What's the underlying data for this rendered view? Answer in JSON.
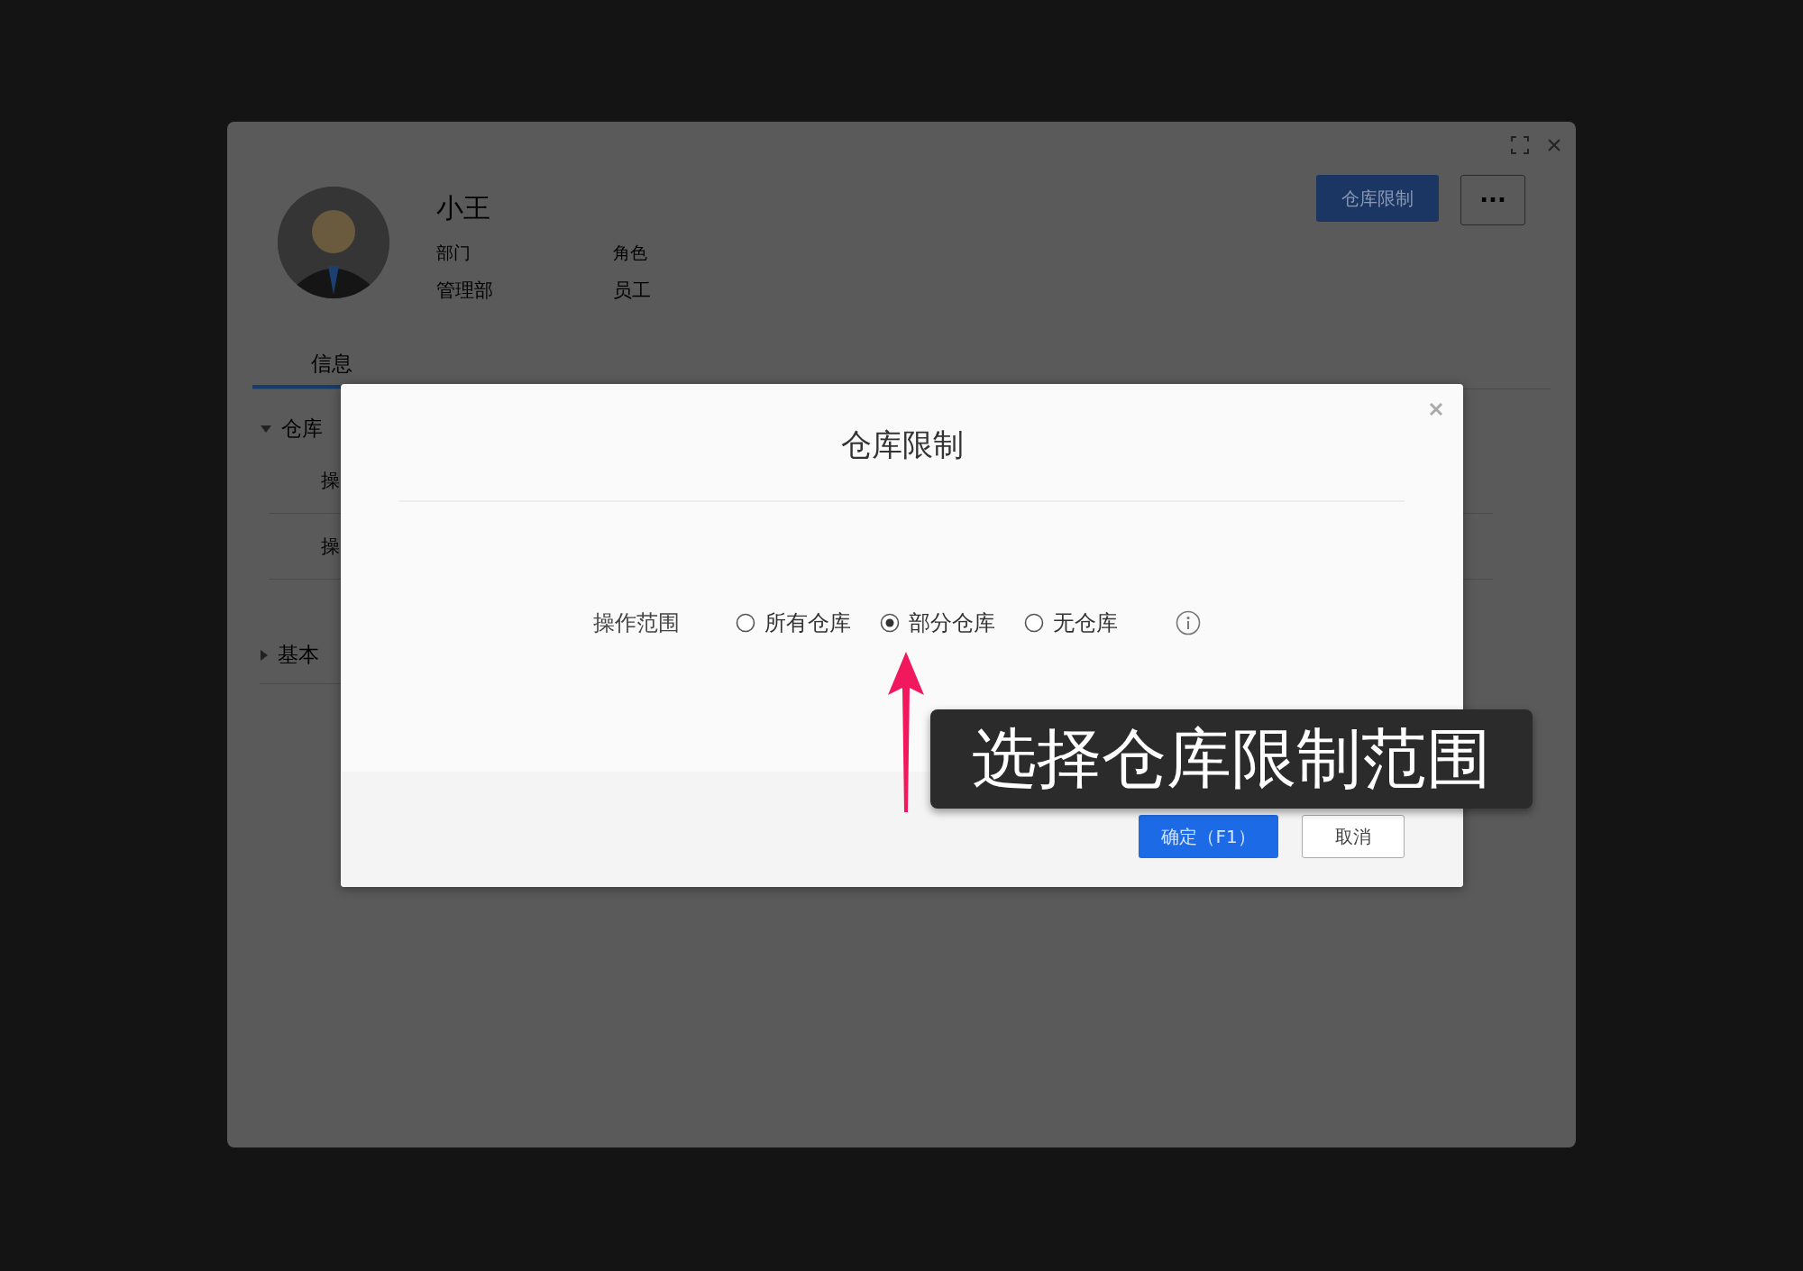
{
  "panel": {
    "name": "小王",
    "fields": [
      {
        "label": "部门",
        "value": "管理部"
      },
      {
        "label": "角色",
        "value": "员工"
      }
    ],
    "primary_button": "仓库限制",
    "more_button": "···",
    "tabs": [
      {
        "label": "信息",
        "selected": true
      }
    ],
    "sections": [
      {
        "title": "仓库",
        "expanded": true,
        "rows": [
          "操",
          "操"
        ]
      },
      {
        "title": "基本",
        "expanded": false
      }
    ]
  },
  "dialog": {
    "title": "仓库限制",
    "field_label": "操作范围",
    "options": [
      {
        "label": "所有仓库",
        "selected": false
      },
      {
        "label": "部分仓库",
        "selected": true
      },
      {
        "label": "无仓库",
        "selected": false
      }
    ],
    "buttons": [
      {
        "label": "确定（F1）",
        "kind": "primary"
      },
      {
        "label": "取消",
        "kind": "default"
      }
    ]
  },
  "annotation": {
    "text": "选择仓库限制范围"
  }
}
